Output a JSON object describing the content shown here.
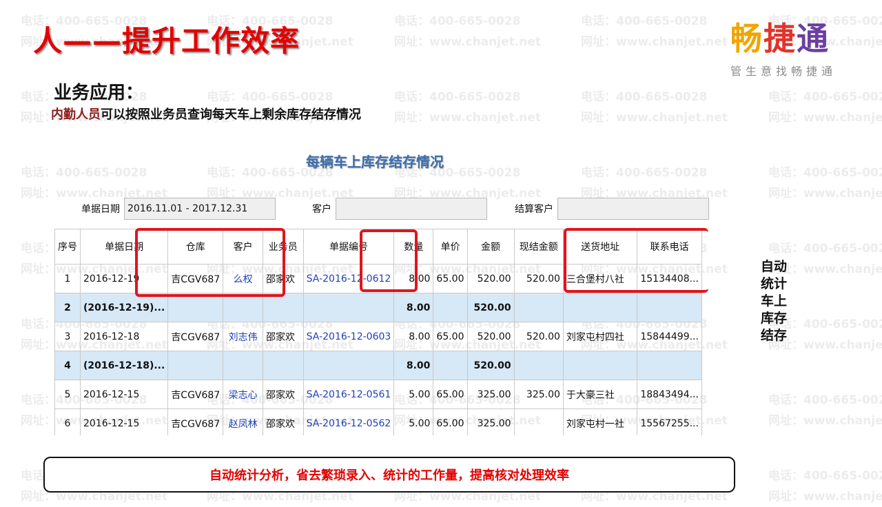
{
  "watermark": {
    "phone": "电话：400-665-0028",
    "site": "网址：www.chanjet.net"
  },
  "title": "人——提升工作效率",
  "logo": {
    "chars": [
      "畅",
      "捷",
      "通"
    ],
    "tagline": "管生意找畅捷通"
  },
  "section_title": "业务应用：",
  "description": {
    "highlight": "内勤人员",
    "rest": "可以按照业务员查询每天车上剩余库存结存情况"
  },
  "table_title": "每辆车上库存结存情况",
  "filters": {
    "date_label": "单据日期",
    "date_value": "2016.11.01 - 2017.12.31",
    "customer_label": "客户",
    "customer_value": "",
    "settle_label": "结算客户",
    "settle_value": ""
  },
  "grid": {
    "headers": [
      "序号",
      "单据日期",
      "仓库",
      "客户",
      "业务员",
      "单据编号",
      "数量",
      "单价",
      "金额",
      "现结金额",
      "送货地址",
      "联系电话"
    ],
    "rows": [
      {
        "type": "row",
        "cells": [
          "1",
          "2016-12-19",
          "吉CGV687",
          "么权",
          "邵家欢",
          "SA-2016-12-0612",
          "8.00",
          "65.00",
          "520.00",
          "520.00",
          "三合堡村八社",
          "15134408..."
        ]
      },
      {
        "type": "sub",
        "cells": [
          "2",
          "(2016-12-19)...",
          "",
          "",
          "",
          "",
          "8.00",
          "",
          "520.00",
          "",
          "",
          ""
        ]
      },
      {
        "type": "row",
        "cells": [
          "3",
          "2016-12-18",
          "吉CGV687",
          "刘志伟",
          "邵家欢",
          "SA-2016-12-0603",
          "8.00",
          "65.00",
          "520.00",
          "520.00",
          "刘家屯村四社",
          "15844499..."
        ]
      },
      {
        "type": "sub",
        "cells": [
          "4",
          "(2016-12-18)...",
          "",
          "",
          "",
          "",
          "8.00",
          "",
          "520.00",
          "",
          "",
          ""
        ]
      },
      {
        "type": "row",
        "cells": [
          "5",
          "2016-12-15",
          "吉CGV687",
          "梁志心",
          "邵家欢",
          "SA-2016-12-0561",
          "5.00",
          "65.00",
          "325.00",
          "325.00",
          "于大豪三社",
          "18843494..."
        ]
      },
      {
        "type": "row",
        "cells": [
          "6",
          "2016-12-15",
          "吉CGV687",
          "赵凤林",
          "邵家欢",
          "SA-2016-12-0562",
          "5.00",
          "65.00",
          "325.00",
          "",
          "刘家屯村一社",
          "15567255..."
        ]
      }
    ]
  },
  "side_note": "自动统计车上库存结存",
  "bottom_message": "自动统计分析，省去繁琐录入、统计的工作量，提高核对处理效率",
  "colors": {
    "title_red": "#e30000",
    "highlight_box": "#e1141b",
    "subtotal_row": "#d7e8f6",
    "link_blue": "#1f3fb8"
  }
}
